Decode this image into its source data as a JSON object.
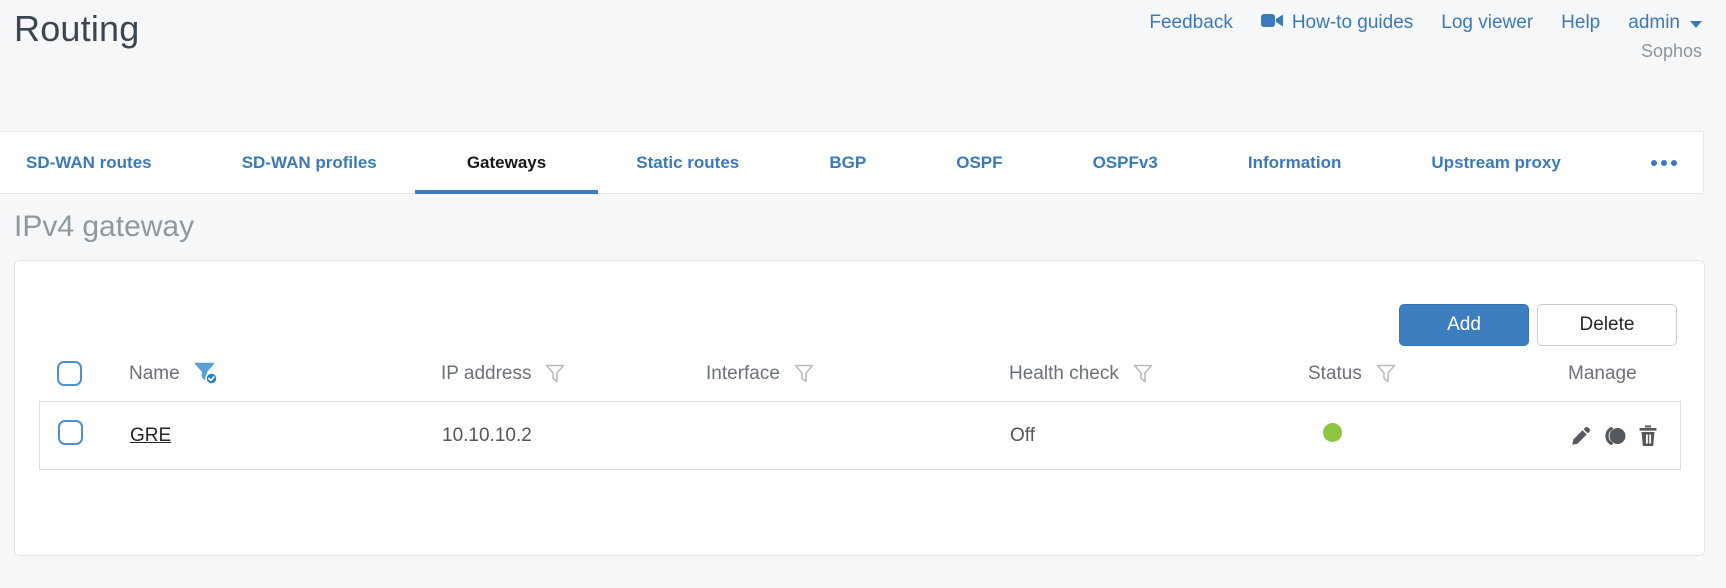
{
  "header": {
    "title": "Routing",
    "links": {
      "feedback": "Feedback",
      "howto_guides": "How-to guides",
      "log_viewer": "Log viewer",
      "help": "Help",
      "user": "admin",
      "brand": "Sophos"
    }
  },
  "tabs": {
    "items": [
      {
        "label": "SD-WAN routes",
        "active": false
      },
      {
        "label": "SD-WAN profiles",
        "active": false
      },
      {
        "label": "Gateways",
        "active": true
      },
      {
        "label": "Static routes",
        "active": false
      },
      {
        "label": "BGP",
        "active": false
      },
      {
        "label": "OSPF",
        "active": false
      },
      {
        "label": "OSPFv3",
        "active": false
      },
      {
        "label": "Information",
        "active": false
      },
      {
        "label": "Upstream proxy",
        "active": false
      }
    ],
    "overflow_icon": "more-horizontal"
  },
  "section": {
    "heading": "IPv4 gateway"
  },
  "toolbar": {
    "add_label": "Add",
    "delete_label": "Delete"
  },
  "table": {
    "columns": {
      "name": "Name",
      "ip": "IP address",
      "interface": "Interface",
      "health": "Health check",
      "status": "Status",
      "manage": "Manage"
    },
    "filters": {
      "name": "active",
      "ip": "inactive",
      "interface": "inactive",
      "health": "inactive",
      "status": "inactive"
    },
    "rows": [
      {
        "name": "GRE",
        "ip": "10.10.10.2",
        "interface": "",
        "health": "Off",
        "status": "up"
      }
    ],
    "manage_icons": [
      "edit-pencil",
      "eclipse-toggle",
      "delete-trash"
    ]
  },
  "colors": {
    "link_blue": "#3a7abc",
    "accent_blue": "#3d7ebf",
    "status_green": "#8dc63f",
    "active_tab_underline": "#3a7cbe",
    "checkbox_blue": "#4e8fd0"
  }
}
